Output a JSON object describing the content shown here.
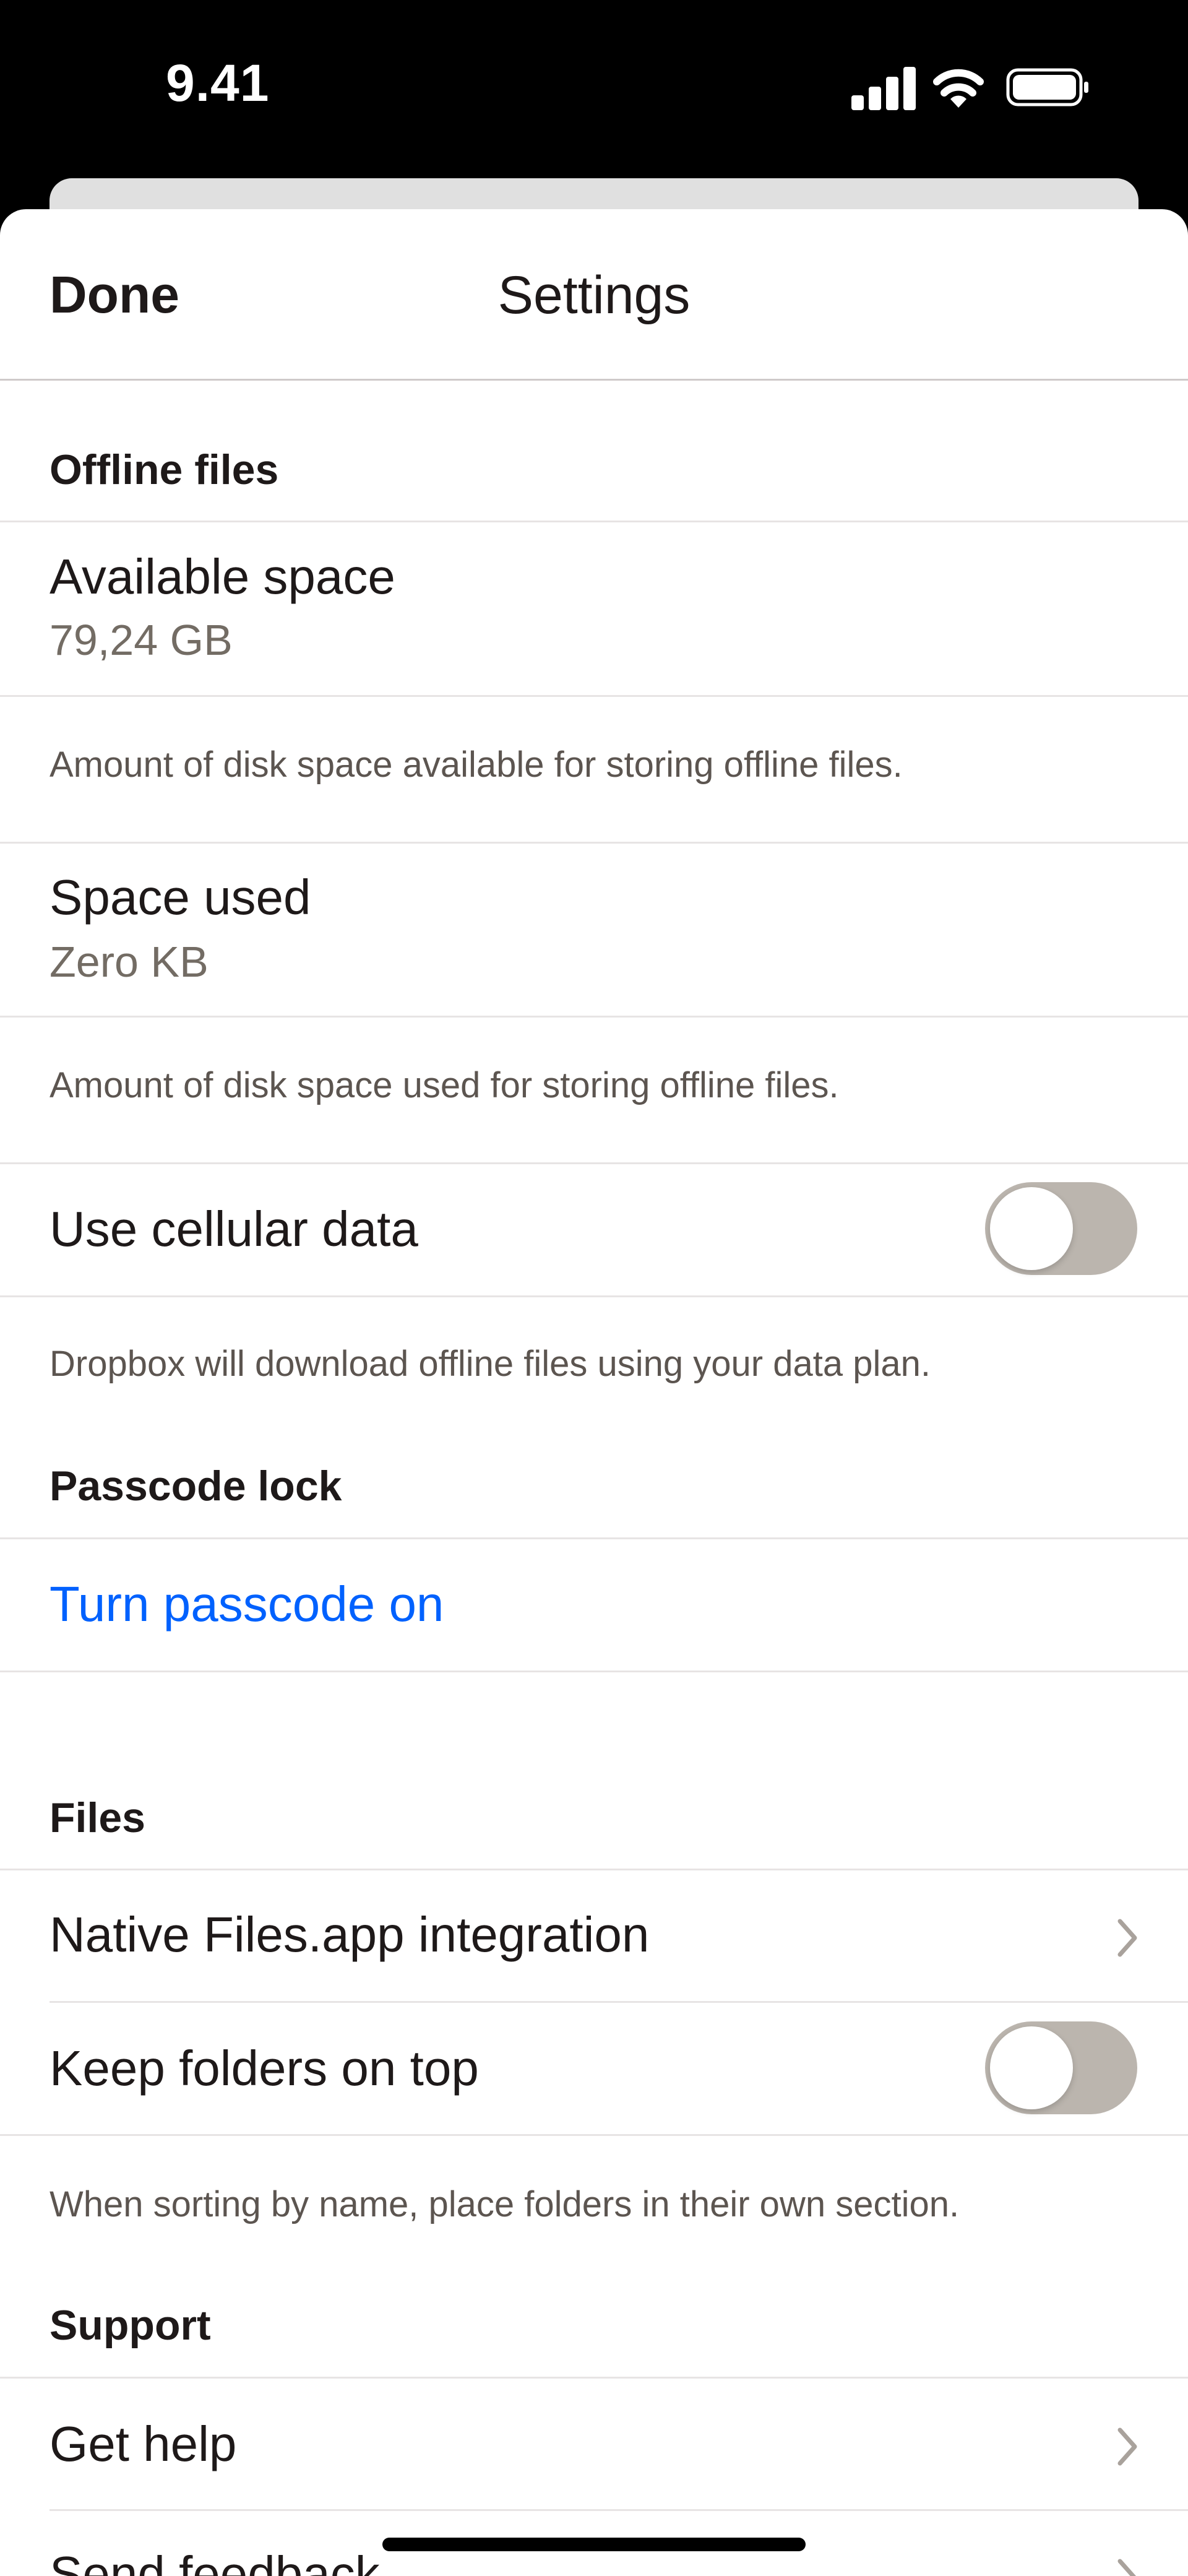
{
  "status_bar": {
    "time": "9.41"
  },
  "nav": {
    "done_label": "Done",
    "title": "Settings"
  },
  "offline_files": {
    "header": "Offline files",
    "available_space": {
      "title": "Available space",
      "value": "79,24 GB",
      "footnote": "Amount of disk space available for storing offline files."
    },
    "space_used": {
      "title": "Space used",
      "value": "Zero KB",
      "footnote": "Amount of disk space used for storing offline files."
    },
    "cellular": {
      "title": "Use cellular data",
      "enabled": false,
      "footnote": "Dropbox will download offline files using your data plan."
    }
  },
  "passcode": {
    "header": "Passcode lock",
    "link": "Turn passcode on"
  },
  "files": {
    "header": "Files",
    "native_integration": "Native Files.app integration",
    "keep_folders": {
      "title": "Keep folders on top",
      "enabled": false,
      "footnote": "When sorting by name, place folders in their own section."
    }
  },
  "support": {
    "header": "Support",
    "get_help": "Get help",
    "send_feedback": "Send feedback"
  },
  "colors": {
    "link_blue": "#0061fe",
    "toggle_off": "#bbb5ae",
    "text_primary": "#1e1919",
    "text_secondary": "#736c64"
  }
}
